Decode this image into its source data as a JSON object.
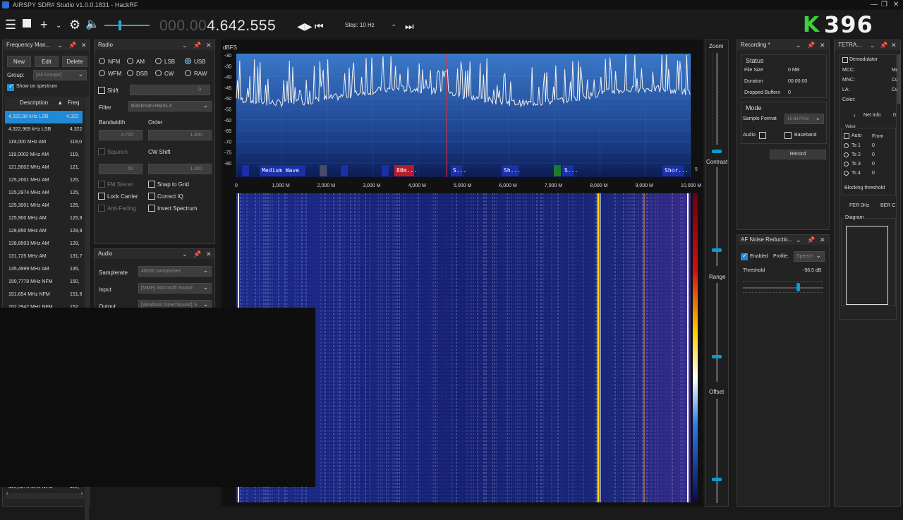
{
  "window": {
    "title": "AIRSPY SDR# Studio v1.0.0.1831 - HackRF"
  },
  "toolbar": {
    "frequency_dim": "000.00",
    "frequency_lit": "4.642.555",
    "step_label": "Step: 10 Hz",
    "logo_text": "396"
  },
  "freq_manager": {
    "title": "Frequency Man...",
    "new_label": "New",
    "edit_label": "Edit",
    "delete_label": "Delete",
    "group_label": "Group:",
    "group_value": "[All Groups]",
    "show_on_spectrum": "Show on spectrum",
    "col_description": "Description",
    "col_freq": "Freq",
    "rows": [
      {
        "desc": "4,322,88 kHz LSB",
        "freq": "4,322"
      },
      {
        "desc": "4,322,969 kHz LSB",
        "freq": "4,322"
      },
      {
        "desc": "119,000 MHz AM",
        "freq": "119,0"
      },
      {
        "desc": "119,0002 MHz AM",
        "freq": "119,"
      },
      {
        "desc": "121,9002 MHz AM",
        "freq": "121,"
      },
      {
        "desc": "125,2001 MHz AM",
        "freq": "125,"
      },
      {
        "desc": "125,2974 MHz AM",
        "freq": "125,"
      },
      {
        "desc": "125,3001 MHz AM",
        "freq": "125,"
      },
      {
        "desc": "125,900 MHz AM",
        "freq": "125,9"
      },
      {
        "desc": "128,850 MHz AM",
        "freq": "128,8"
      },
      {
        "desc": "128,8503 MHz AM",
        "freq": "128,"
      },
      {
        "desc": "131,725 MHz AM",
        "freq": "131,7"
      },
      {
        "desc": "135,4999 MHz AM",
        "freq": "135,"
      },
      {
        "desc": "150,7778 MHz NFM",
        "freq": "150,"
      },
      {
        "desc": "151,654 MHz NFM",
        "freq": "151,6"
      },
      {
        "desc": "152,2947 MHz NFM",
        "freq": "152,"
      }
    ],
    "last_row": {
      "desc": "422,5873 MHz NFM",
      "freq": "422,"
    }
  },
  "radio": {
    "title": "Radio",
    "modes": [
      "NFM",
      "AM",
      "LSB",
      "USB",
      "WFM",
      "DSB",
      "CW",
      "RAW"
    ],
    "selected_mode": "USB",
    "shift_label": "Shift",
    "shift_value": "0",
    "filter_label": "Filter",
    "filter_value": "Blackman-Harris 4",
    "bandwidth_label": "Bandwidth",
    "order_label": "Order",
    "bandwidth_value": "4.700",
    "order_value": "1.000",
    "squelch_label": "Squelch",
    "cw_shift_label": "CW Shift",
    "squelch_value": "50",
    "cw_shift_value": "1.000",
    "fm_stereo": "FM Stereo",
    "snap_to_grid": "Snap to Grid",
    "lock_carrier": "Lock Carrier",
    "correct_iq": "Correct IQ",
    "anti_fading": "Anti-Fading",
    "invert_spectrum": "Invert Spectrum"
  },
  "audio": {
    "title": "Audio",
    "samplerate_label": "Samplerate",
    "samplerate_value": "48000 sample/sec",
    "input_label": "Input",
    "input_value": "[MME] Microsoft Sound",
    "output_label": "Output",
    "output_value": "[Windows DirectSound] S"
  },
  "spectrum": {
    "dbfs_label": "dBFS",
    "y_ticks": [
      "-30",
      "-35",
      "-40",
      "-45",
      "-50",
      "-55",
      "-60",
      "-65",
      "-70",
      "-75",
      "-80"
    ],
    "x_ticks": [
      "0",
      "1,000 M",
      "2,000 M",
      "3,000 M",
      "4,000 M",
      "5,000 M",
      "6,000 M",
      "7,000 M",
      "8,000 M",
      "9,000 M",
      "10,000 M"
    ],
    "bands": [
      "Medium Wave",
      "80m...",
      "S...",
      "Sh...",
      "S...",
      "Shor..."
    ],
    "side_num": "5"
  },
  "sliders": {
    "zoom": "Zoom",
    "contrast": "Contrast",
    "range": "Range",
    "offset": "Offset"
  },
  "recording": {
    "title": "Recording *",
    "status_header": "Status",
    "file_size_label": "File Size",
    "file_size_value": "0 MB",
    "duration_label": "Duration",
    "duration_value": "00:00:00",
    "dropped_label": "Dropped Buffers",
    "dropped_value": "0",
    "mode_header": "Mode",
    "sample_format_label": "Sample Format",
    "sample_format_value": "16 Bit PCM",
    "audio_label": "Audio",
    "baseband_label": "Baseband",
    "record_label": "Record"
  },
  "af_noise": {
    "title": "AF Noise Reductio...",
    "enabled_label": "Enabled",
    "profile_label": "Profile:",
    "profile_value": "Speech",
    "threshold_label": "Threshold",
    "threshold_value": "-98,5 dB"
  },
  "tetra": {
    "title": "TETRA...",
    "demodulator": "Demodulator",
    "mcc": "MCC:",
    "mnc": "MNC:",
    "la": "LA:",
    "color": "Color:",
    "mcc_val": "Ma",
    "mnc_val": "Cu",
    "la_val": "Cu",
    "color_val": "",
    "net_info": "Net Info",
    "net_info_count": "0",
    "voice_header": "Voice",
    "auto": "Auto",
    "from": "From",
    "ts": [
      "Ts 1",
      "Ts 2",
      "Ts 3",
      "Ts 4"
    ],
    "ts_vals": [
      "0",
      "0",
      "0",
      "0"
    ],
    "blocking": "Blocking threshold",
    "fer": "FER 0Hz",
    "ber": "BER C",
    "diagram": "Diagram"
  }
}
